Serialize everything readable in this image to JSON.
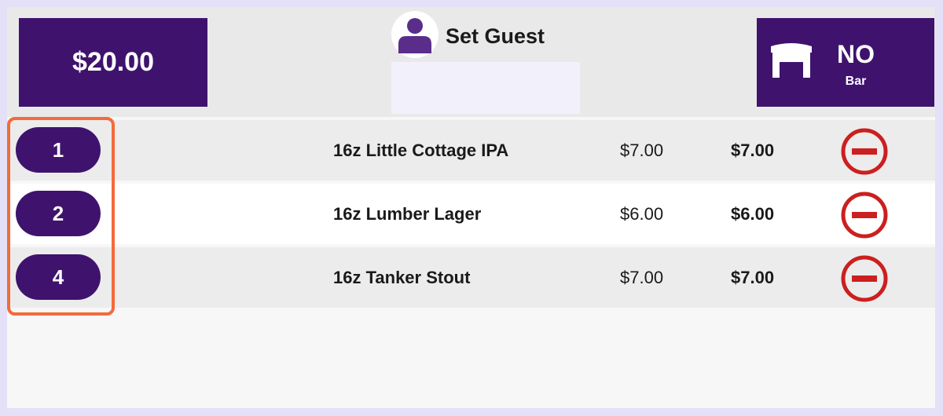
{
  "header": {
    "total": "$20.00",
    "guest_label": "Set Guest",
    "guest_value": "",
    "table_status": "NO",
    "table_name": "Bar"
  },
  "items": [
    {
      "qty": "1",
      "name": "16z Little Cottage IPA",
      "price": "$7.00",
      "total": "$7.00"
    },
    {
      "qty": "2",
      "name": "16z Lumber Lager",
      "price": "$6.00",
      "total": "$6.00"
    },
    {
      "qty": "4",
      "name": "16z Tanker Stout",
      "price": "$7.00",
      "total": "$7.00"
    }
  ],
  "icons": {
    "avatar": "person-icon",
    "table": "table-icon",
    "remove": "minus-circle-icon"
  },
  "colors": {
    "brand": "#3f136d",
    "remove": "#cc1f1f",
    "highlight": "#f46a3b"
  }
}
